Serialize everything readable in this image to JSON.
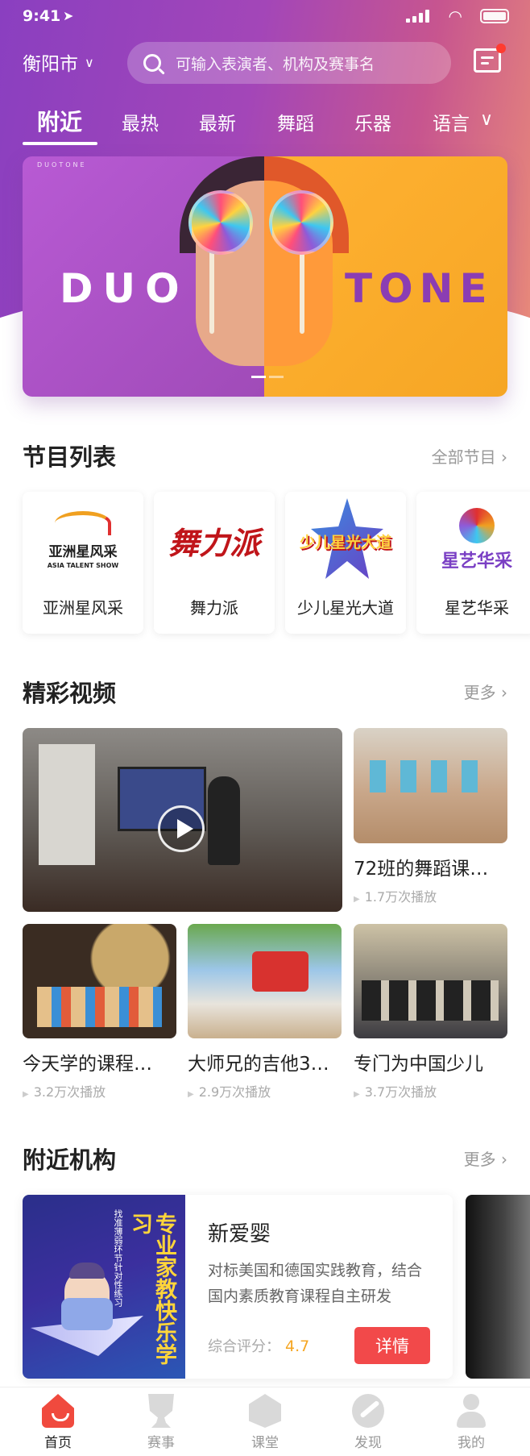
{
  "status_bar": {
    "time": "9:41",
    "location_icon": "location-arrow-icon",
    "signal_icon": "cellular-signal-icon",
    "wifi_icon": "wifi-icon",
    "battery_icon": "battery-icon"
  },
  "header": {
    "city": "衡阳市",
    "search_placeholder": "可输入表演者、机构及赛事名",
    "message_icon": "message-icon",
    "has_unread": true
  },
  "tabs": [
    {
      "label": "附近",
      "active": true
    },
    {
      "label": "最热",
      "active": false
    },
    {
      "label": "最新",
      "active": false
    },
    {
      "label": "舞蹈",
      "active": false
    },
    {
      "label": "乐器",
      "active": false
    },
    {
      "label": "语言",
      "active": false
    }
  ],
  "banner": {
    "small_text": "DUOTONE",
    "left_text": "DUO",
    "right_text": "TONE",
    "slide_count": 2,
    "active_slide": 1
  },
  "programs": {
    "title": "节目列表",
    "more": "全部节目",
    "items": [
      {
        "name": "亚洲星风采",
        "logo_text": "亚洲星风采",
        "logo_sub": "ASIA TALENT SHOW"
      },
      {
        "name": "舞力派",
        "logo_text": "舞力派"
      },
      {
        "name": "少儿星光大道",
        "logo_text": "少儿星光大道"
      },
      {
        "name": "星艺华采",
        "logo_text": "星艺华采"
      }
    ]
  },
  "videos": {
    "title": "精彩视频",
    "more": "更多",
    "items": [
      {
        "title": "72班的舞蹈课…",
        "plays": "1.7万次播放"
      },
      {
        "title": "今天学的课程…",
        "plays": "3.2万次播放"
      },
      {
        "title": "大师兄的吉他3…",
        "plays": "2.9万次播放"
      },
      {
        "title": "专门为中国少儿",
        "plays": "3.7万次播放"
      }
    ]
  },
  "nearby": {
    "title": "附近机构",
    "more": "更多",
    "org": {
      "image_tag": "专业家教快乐学习",
      "image_sub": "找准薄弱环节针对性练习",
      "name": "新爱婴",
      "desc": "对标美国和德国实践教育，结合国内素质教育课程自主研发",
      "score_label": "综合评分：",
      "score": "4.7",
      "button": "详情"
    }
  },
  "tabbar": [
    {
      "label": "首页",
      "icon": "home-icon",
      "active": true
    },
    {
      "label": "赛事",
      "icon": "trophy-icon",
      "active": false
    },
    {
      "label": "课堂",
      "icon": "classroom-icon",
      "active": false
    },
    {
      "label": "发现",
      "icon": "discover-icon",
      "active": false
    },
    {
      "label": "我的",
      "icon": "profile-icon",
      "active": false
    }
  ]
}
